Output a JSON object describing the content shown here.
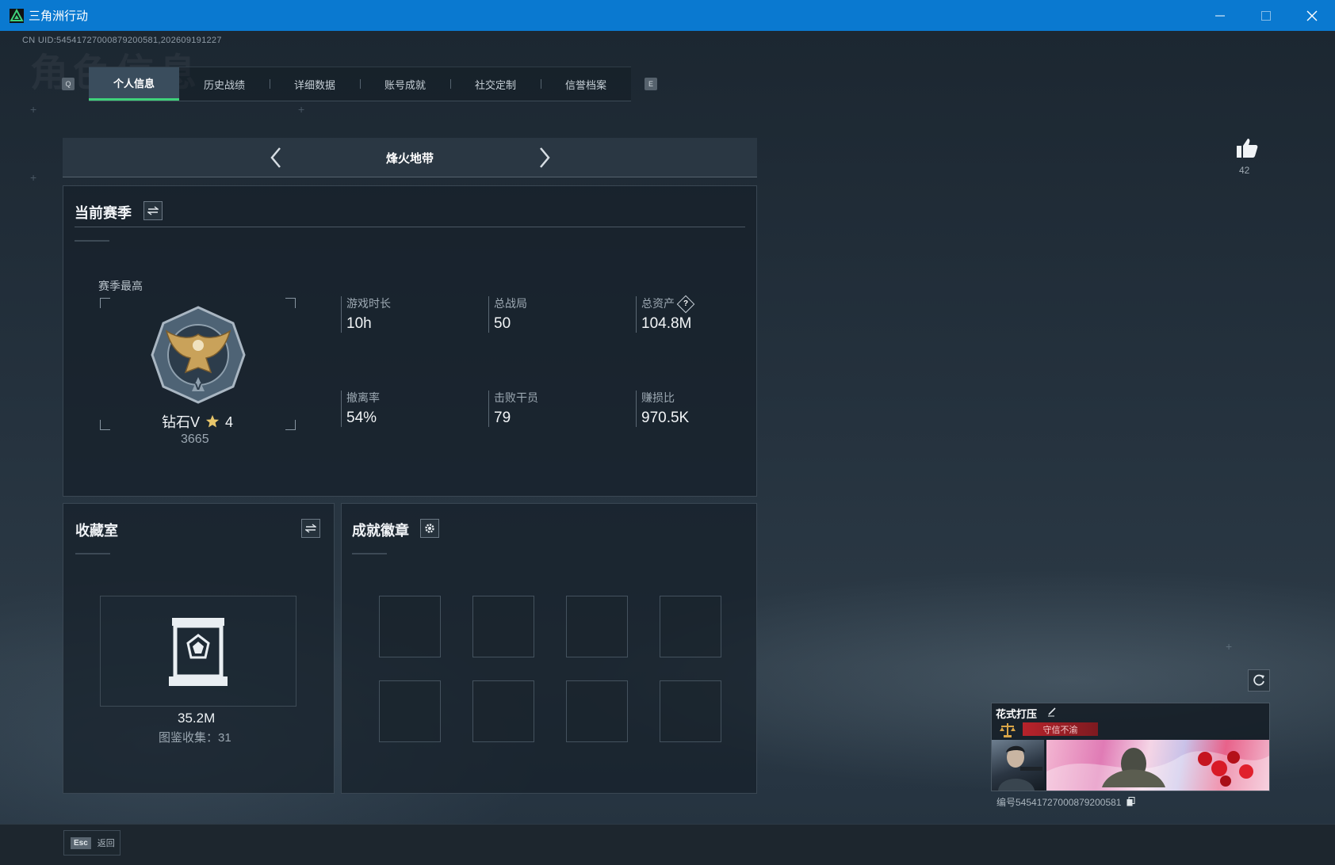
{
  "window": {
    "title": "三角洲行动"
  },
  "uid_line": "CN UID:5454172700087920058​1,202609191227",
  "tabs": {
    "left_key": "Q",
    "right_key": "E",
    "items": [
      {
        "label": "个人信息"
      },
      {
        "label": "历史战绩"
      },
      {
        "label": "详细数据"
      },
      {
        "label": "账号成就"
      },
      {
        "label": "社交定制"
      },
      {
        "label": "信誉档案"
      }
    ]
  },
  "mode_selector": {
    "label": "烽火地带"
  },
  "season": {
    "title": "当前赛季",
    "best_label": "赛季最高",
    "rank_name": "钻石V",
    "rank_stars": "4",
    "rank_score": "3665",
    "stats": [
      {
        "label": "游戏时长",
        "value": "10h"
      },
      {
        "label": "总战局",
        "value": "50"
      },
      {
        "label": "总资产",
        "value": "104.8M"
      },
      {
        "label": "撤离率",
        "value": "54%"
      },
      {
        "label": "击败干员",
        "value": "79"
      },
      {
        "label": "赚损比",
        "value": "970.5K"
      }
    ],
    "help_symbol": "?"
  },
  "collection": {
    "title": "收藏室",
    "value": "35.2M",
    "count_text": "图鉴收集：31"
  },
  "achievements": {
    "title": "成就徽章",
    "slots": 8
  },
  "likes": {
    "count": "42"
  },
  "profile_card": {
    "name": "花式打压",
    "tag": "守信不渝",
    "id_text": "编号5454172700087920058​1"
  },
  "footer": {
    "esc_key": "Esc",
    "esc_label": "返回"
  },
  "colors": {
    "titlebar": "#0a79d0",
    "active_tab_underline": "#3fd17a",
    "tag_red": "#b8232b"
  }
}
